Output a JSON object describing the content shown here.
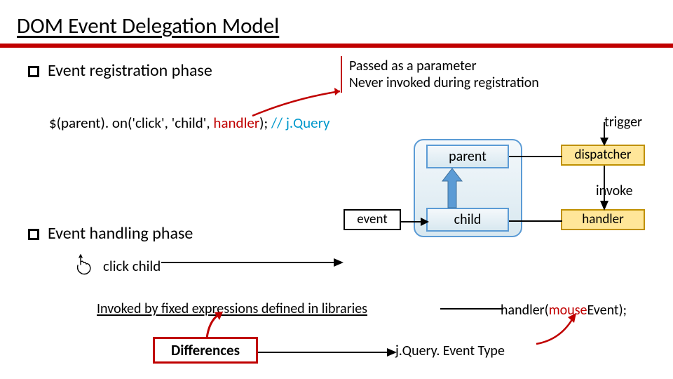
{
  "title": "DOM Event Delegation Model",
  "bullets": {
    "registration": "Event registration phase",
    "handling": "Event handling phase"
  },
  "note": {
    "line1": "Passed as a parameter",
    "line2": "Never invoked during registration"
  },
  "code": {
    "prefix": "$(parent). on('click', 'child', ",
    "handler": "handler",
    "suffix": ");  ",
    "comment": "// j.Query"
  },
  "diagram": {
    "trigger_label": "trigger",
    "parent": "parent",
    "child": "child",
    "dispatcher": "dispatcher",
    "handler": "handler",
    "invoke": "invoke",
    "event": "event"
  },
  "click_child": "click child",
  "invoked_text": " Invoked by fixed expressions defined in libraries ",
  "handler_call": {
    "prefix": "handler(",
    "mouse": "mouse",
    "suffix": "Event);"
  },
  "differences": "Differences",
  "jq_type": "j.Query. Event Type"
}
